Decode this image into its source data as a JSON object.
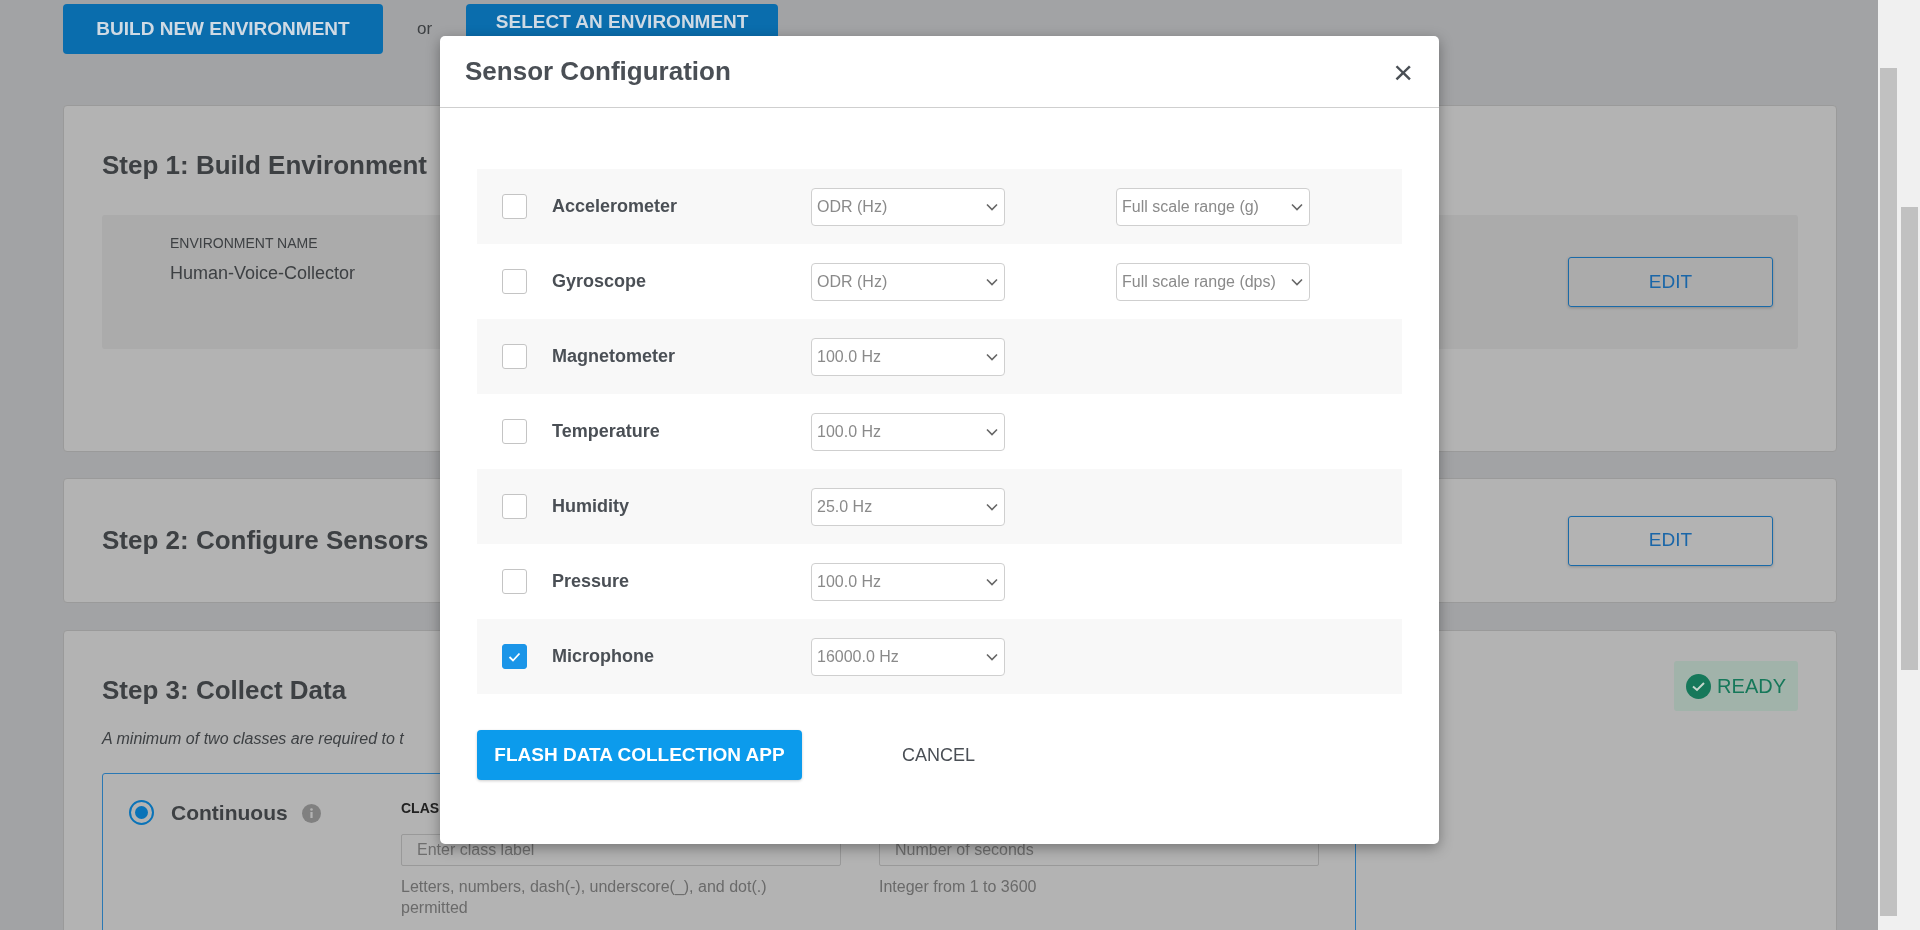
{
  "top_actions": {
    "build_button": "BUILD NEW ENVIRONMENT",
    "separator": "or",
    "select_button": "SELECT AN ENVIRONMENT"
  },
  "steps": [
    {
      "kind": "environment",
      "title": "Step 1: Build Environment",
      "field_label": "ENVIRONMENT NAME",
      "field_value": "Human-Voice-Collector",
      "button": "EDIT"
    },
    {
      "kind": "sensors",
      "title": "Step 2: Configure Sensors",
      "button": "EDIT"
    },
    {
      "kind": "collect",
      "title": "Step 3: Collect Data",
      "status": "READY",
      "note": "A minimum of two classes are required to t",
      "mode": {
        "label": "Continuous",
        "selected": true
      },
      "class_label": "CLAS",
      "class_placeholder": "Enter class label",
      "class_hint": "Letters, numbers, dash(-), underscore(_), and dot(.) permitted",
      "seconds_placeholder": "Number of seconds",
      "seconds_hint": "Integer from 1 to 3600"
    }
  ],
  "dialog": {
    "title": "Sensor Configuration",
    "close": "×",
    "sensors": [
      {
        "name": "Accelerometer",
        "checked": false,
        "rate": "ODR (Hz)",
        "range": "Full scale range (g)"
      },
      {
        "name": "Gyroscope",
        "checked": false,
        "rate": "ODR (Hz)",
        "range": "Full scale range (dps)"
      },
      {
        "name": "Magnetometer",
        "checked": false,
        "rate": "100.0 Hz"
      },
      {
        "name": "Temperature",
        "checked": false,
        "rate": "100.0 Hz"
      },
      {
        "name": "Humidity",
        "checked": false,
        "rate": "25.0 Hz"
      },
      {
        "name": "Pressure",
        "checked": false,
        "rate": "100.0 Hz"
      },
      {
        "name": "Microphone",
        "checked": true,
        "rate": "16000.0 Hz"
      }
    ],
    "primary_button": "FLASH DATA COLLECTION APP",
    "cancel_button": "CANCEL"
  }
}
